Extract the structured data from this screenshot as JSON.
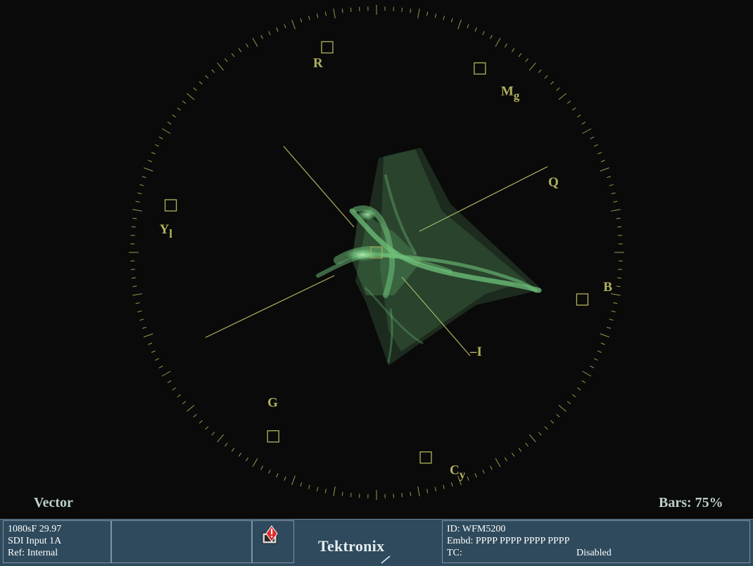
{
  "display": {
    "mode": "Vector",
    "bars": "Bars: 75%",
    "trace_color": "#6fc27a",
    "graticule_color": "#b3b25e",
    "background": "#0a0a0a"
  },
  "targets": [
    {
      "label": "R",
      "angle": 103.5
    },
    {
      "label": "Mg",
      "angle": 60.7
    },
    {
      "label": "B",
      "angle": -12.9
    },
    {
      "label": "Cy",
      "angle": -76.5
    },
    {
      "label": "G",
      "angle": -119.3
    },
    {
      "label": "Yl",
      "angle": 167.1
    }
  ],
  "axes": {
    "Q": "Q",
    "I": "–I"
  },
  "status_bar": {
    "left": [
      "1080sF 29.97",
      "SDI Input 1A",
      "Ref: Internal"
    ],
    "alarm_icon": "alarm-warning-icon",
    "brand": "Tektronix",
    "right": {
      "id": "ID: WFM5200",
      "embd": "Embd: PPPP PPPP PPPP PPPP",
      "tc_label": "TC:",
      "tc_value": "Disabled"
    },
    "colors": {
      "bar": "#2e4a5c",
      "border": "#7f94a3",
      "alarm": "#e22b2b"
    }
  }
}
